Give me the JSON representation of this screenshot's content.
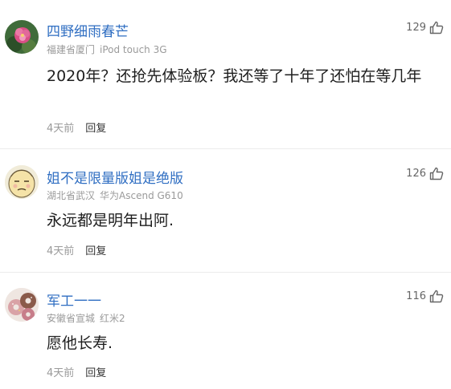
{
  "comments": [
    {
      "username": "四野细雨春芒",
      "location": "福建省厦门",
      "device": "iPod touch 3G",
      "likes": "129",
      "text": "2020年？还抢先体验板？我还等了十年了还怕在等几年",
      "time": "4天前",
      "reply_label": "回复",
      "avatar_icon": "flower-avatar-icon"
    },
    {
      "username": "姐不是限量版姐是绝版",
      "location": "湖北省武汉",
      "device": "华为Ascend G610",
      "likes": "126",
      "text": "永远都是明年出阿.",
      "time": "4天前",
      "reply_label": "回复",
      "avatar_icon": "cartoon-face-avatar-icon"
    },
    {
      "username": "军工一一",
      "location": "安徽省宣城",
      "device": "红米2",
      "likes": "116",
      "text": "愿他长寿.",
      "time": "4天前",
      "reply_label": "回复",
      "avatar_icon": "donut-avatar-icon"
    }
  ],
  "colors": {
    "username": "#2f6ec2",
    "meta": "#9a9a9a",
    "body": "#1e1e1e"
  }
}
